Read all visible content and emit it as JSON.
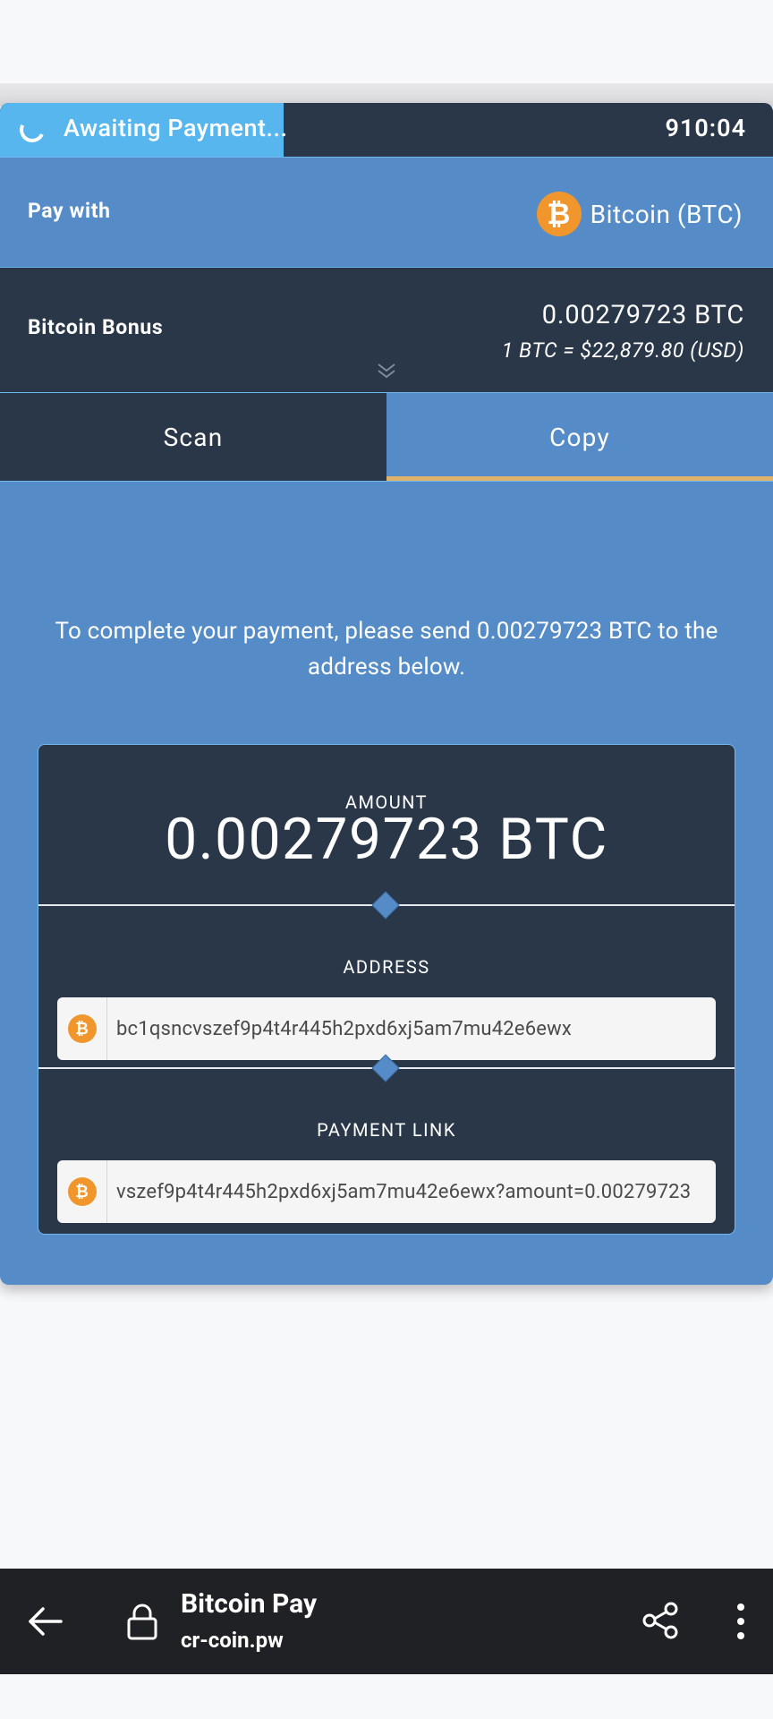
{
  "status": {
    "text": "Awaiting Payment...",
    "timer": "910:04",
    "progress_percent": 36.7
  },
  "pay_with": {
    "label": "Pay with",
    "currency": "Bitcoin (BTC)",
    "coin_icon": "bitcoin-icon",
    "coin_glyph": "₿"
  },
  "bonus": {
    "label": "Bitcoin Bonus",
    "amount": "0.00279723 BTC",
    "rate": "1 BTC = $22,879.80 (USD)"
  },
  "tabs": [
    {
      "label": "Scan",
      "active": false
    },
    {
      "label": "Copy",
      "active": true
    }
  ],
  "instruction": "To complete your payment, please send 0.00279723 BTC to the address below.",
  "details": {
    "amount_label": "AMOUNT",
    "amount_value": "0.00279723 BTC",
    "address_label": "ADDRESS",
    "address_value": "bc1qsncvszef9p4t4r445h2pxd6xj5am7mu42e6ewx",
    "link_label": "PAYMENT LINK",
    "link_value": "vszef9p4t4r445h2pxd6xj5am7mu42e6ewx?amount=0.00279723"
  },
  "browser": {
    "title": "Bitcoin Pay",
    "url": "cr-coin.pw"
  },
  "colors": {
    "primary_blue": "#558cc8",
    "dark_navy": "#293749",
    "progress_blue": "#57b6ee",
    "bitcoin_orange": "#f0962c",
    "active_tab_underline": "#e0b26a"
  }
}
